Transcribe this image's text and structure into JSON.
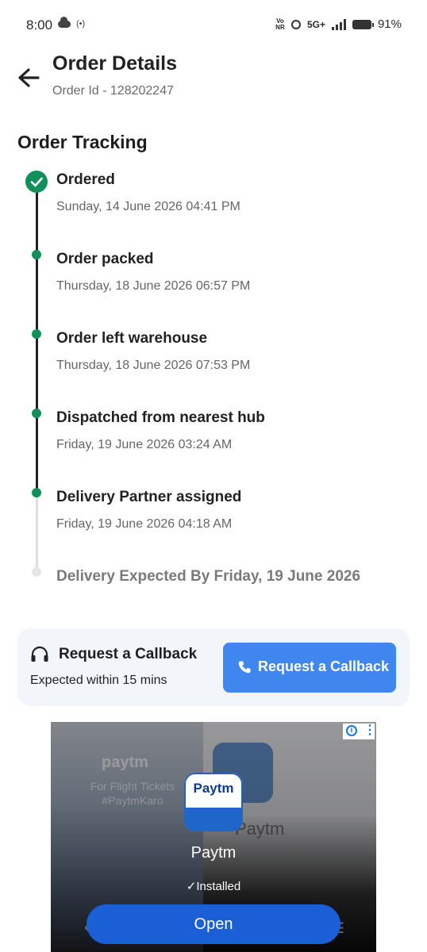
{
  "status_bar": {
    "time": "8:00",
    "radio": "(•)",
    "vonr": "Vo NR",
    "network": "5G+",
    "battery": "91%"
  },
  "header": {
    "title": "Order Details",
    "order_id": "Order Id - 128202247"
  },
  "tracking": {
    "section_title": "Order Tracking",
    "accent_color": "#12905a",
    "steps": [
      {
        "title": "Ordered",
        "time": "Sunday, 14 June 2026 04:41 PM",
        "done": true
      },
      {
        "title": "Order packed",
        "time": "Thursday, 18 June 2026 06:57 PM",
        "done": true
      },
      {
        "title": "Order left warehouse",
        "time": "Thursday, 18 June 2026 07:53 PM",
        "done": true
      },
      {
        "title": "Dispatched from nearest hub",
        "time": "Friday, 19 June 2026 03:24 AM",
        "done": true
      },
      {
        "title": "Delivery Partner assigned",
        "time": "Friday, 19 June 2026 04:18 AM",
        "done": true
      }
    ],
    "pending": "Delivery Expected By Friday, 19 June 2026"
  },
  "callback": {
    "title": "Request a Callback",
    "subtitle": "Expected within 15 mins",
    "button_label": "Request a Callback",
    "button_color": "#3f86ee"
  },
  "ad": {
    "left_brand": "paytm",
    "left_text": "For Flight Tickets #PaytmKaro",
    "icon_text": "Paytm",
    "app_name": "Paytm",
    "bg_name": "Paytm",
    "installed": "Installed",
    "open_label": "Open"
  }
}
